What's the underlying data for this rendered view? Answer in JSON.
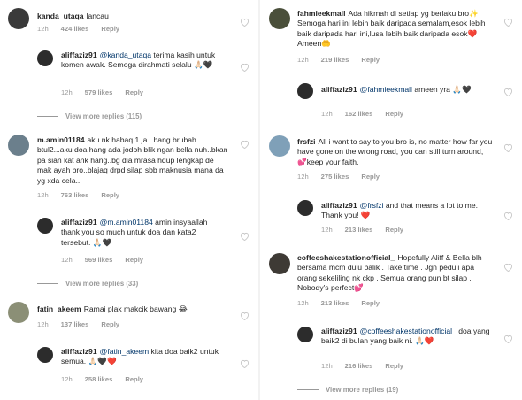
{
  "left_column": [
    {
      "username": "kanda_utaqa",
      "text": "lancau",
      "time": "12h",
      "likes": "424 likes",
      "reply": "Reply"
    },
    {
      "username": "aliffaziz91",
      "mention": "@kanda_utaqa",
      "text": " terima kasih untuk komen awak. Semoga dirahmati selalu 🙏🏻🖤",
      "time": "12h",
      "likes": "579 likes",
      "reply": "Reply"
    },
    {
      "view_more": "View more replies (115)"
    },
    {
      "username": "m.amin01184",
      "text": "aku nk habaq 1 ja...hang brubah btul2...aku doa hang ada jodoh blik ngan bella nuh..bkan pa sian kat ank hang..bg dia mrasa hdup lengkap de mak ayah bro..blajaq drpd silap sbb maknusia mana da yg xda cela...",
      "time": "12h",
      "likes": "763 likes",
      "reply": "Reply"
    },
    {
      "username": "aliffaziz91",
      "mention": "@m.amin01184",
      "text": " amin insyaallah thank you so much untuk doa dan kata2 tersebut. 🙏🏻🖤",
      "time": "12h",
      "likes": "569 likes",
      "reply": "Reply"
    },
    {
      "view_more": "View more replies (33)"
    },
    {
      "username": "fatin_akeem",
      "text": "Ramai plak makcik bawang 😂",
      "time": "12h",
      "likes": "137 likes",
      "reply": "Reply"
    },
    {
      "username": "aliffaziz91",
      "mention": "@fatin_akeem",
      "text": " kita doa baik2 untuk semua. 🙏🏻🖤❤️",
      "time": "12h",
      "likes": "258 likes",
      "reply": "Reply"
    }
  ],
  "right_column": [
    {
      "username": "fahmieekmall",
      "text": "Ada hikmah di setiap yg berlaku bro✨ Semoga hari ini lebih baik daripada semalam,esok lebih baik daripada hari ini,lusa lebih baik daripada esok❤️ Ameen🤲",
      "time": "12h",
      "likes": "219 likes",
      "reply": "Reply"
    },
    {
      "username": "aliffaziz91",
      "mention": "@fahmieekmall",
      "text": " ameen yra 🙏🏻🖤",
      "time": "12h",
      "likes": "162 likes",
      "reply": "Reply"
    },
    {
      "username": "frsfzi",
      "text": "All i want to say to you bro is, no matter how far you have gone on the wrong road, you can still turn around, 💕keep your faith,",
      "time": "12h",
      "likes": "275 likes",
      "reply": "Reply"
    },
    {
      "username": "aliffaziz91",
      "mention": "@frsfzi",
      "text": " and that means a lot to me. Thank you! ❤️",
      "time": "12h",
      "likes": "213 likes",
      "reply": "Reply"
    },
    {
      "username": "coffeeshakestationofficial_",
      "text": "Hopefully Aliff & Bella blh bersama mcm dulu balik . Take time . Jgn peduli apa orang sekeliling nk ckp . Semua orang pun bt silap . Nobody's perfect💕",
      "time": "12h",
      "likes": "213 likes",
      "reply": "Reply"
    },
    {
      "username": "aliffaziz91",
      "mention": "@coffeeshakestationofficial_",
      "text": " doa yang baik2 di bulan yang baik ni. 🙏🏻❤️",
      "time": "12h",
      "likes": "216 likes",
      "reply": "Reply"
    },
    {
      "view_more": "View more replies (19)"
    }
  ],
  "colors": {
    "mention": "#003569",
    "meta": "#999999",
    "text": "#262626",
    "heart_outline": "#c7c7c7"
  }
}
